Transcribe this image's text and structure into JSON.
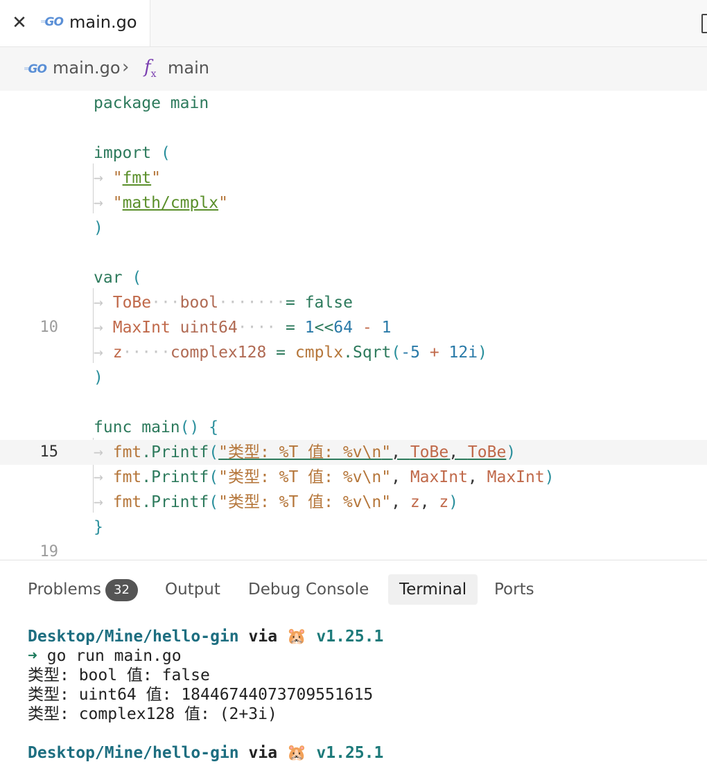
{
  "tab": {
    "close_icon": "close-icon",
    "label": "main.go",
    "logo_text": "GO"
  },
  "breadcrumb": {
    "file": "main.go",
    "separator": "›",
    "symbol_icon": "function-icon",
    "symbol_fx": "f",
    "symbol_sub": "x",
    "symbol": "main"
  },
  "editor": {
    "line_numbers": {
      "l10": "10",
      "l15": "15",
      "l19": "19"
    },
    "lines": {
      "package_kw": "package",
      "package_name": "main",
      "import_kw": "import",
      "open_paren": "(",
      "close_paren": ")",
      "fmt": "fmt",
      "cmplx_path": "math/cmplx",
      "var_kw": "var",
      "tobe": "ToBe",
      "bool": "bool",
      "false": "false",
      "maxint": "MaxInt",
      "uint64": "uint64",
      "one": "1",
      "shift": "<<",
      "sixtyfour": "64",
      "minus": "-",
      "z": "z",
      "complex128": "complex128",
      "cmplx": "cmplx",
      "sqrt": "Sqrt",
      "neg5": "-5",
      "plus": "+",
      "twelve_i": "12i",
      "func_kw": "func",
      "main": "main",
      "parens": "()",
      "open_brace": "{",
      "close_brace": "}",
      "fmt_pkg": "fmt",
      "printf": "Printf",
      "format": "类型: %T 值: %v\\n",
      "arg_tobe": "ToBe",
      "arg_maxint": "MaxInt",
      "arg_z": "z"
    }
  },
  "panel": {
    "tabs": {
      "problems": "Problems",
      "problems_count": "32",
      "output": "Output",
      "debug": "Debug Console",
      "terminal": "Terminal",
      "ports": "Ports"
    },
    "terminal": {
      "path": "Desktop/Mine/hello-gin",
      "via": "via",
      "emoji": "🐹",
      "version": "v1.25.1",
      "prompt_arrow": "➜",
      "command": "go run main.go",
      "out1": "类型: bool 值: false",
      "out2": "类型: uint64 值: 18446744073709551615",
      "out3": "类型: complex128 值: (2+3i)"
    }
  }
}
